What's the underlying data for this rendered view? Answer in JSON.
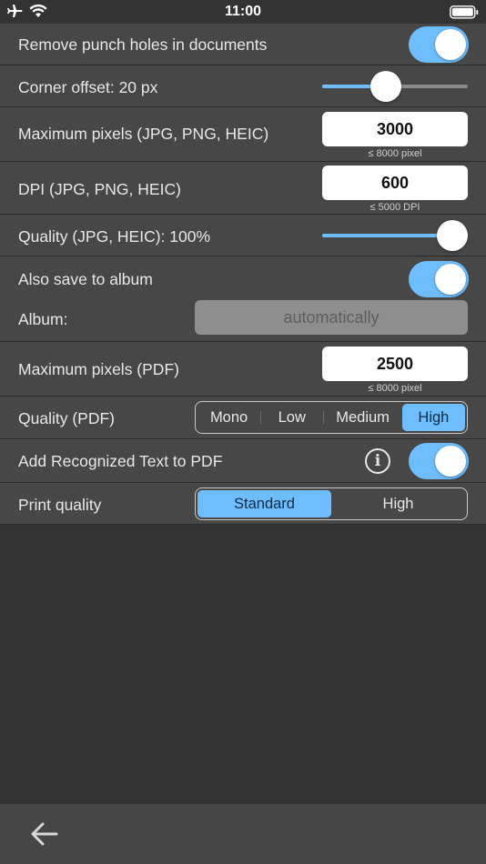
{
  "status": {
    "time": "11:00"
  },
  "rows": {
    "punch": {
      "label": "Remove punch holes in documents",
      "on": true
    },
    "corner": {
      "label": "Corner offset: 20 px",
      "fraction": 0.42
    },
    "maxpx": {
      "label": "Maximum pixels (JPG, PNG, HEIC)",
      "value": "3000",
      "hint": "≤ 8000 pixel"
    },
    "dpi": {
      "label": "DPI (JPG, PNG, HEIC)",
      "value": "600",
      "hint": "≤ 5000 DPI"
    },
    "quality": {
      "label": "Quality (JPG, HEIC): 100%",
      "fraction": 1.0
    },
    "album_save": {
      "label": "Also save to album",
      "on": true
    },
    "album": {
      "label": "Album:",
      "value": "automatically"
    },
    "maxpx_pdf": {
      "label": "Maximum pixels (PDF)",
      "value": "2500",
      "hint": "≤ 8000 pixel"
    },
    "quality_pdf": {
      "label": "Quality (PDF)",
      "options": [
        "Mono",
        "Low",
        "Medium",
        "High"
      ],
      "selected": "High"
    },
    "ocr": {
      "label": "Add Recognized Text to PDF",
      "on": true,
      "info": "i"
    },
    "print": {
      "label": "Print quality",
      "options": [
        "Standard",
        "High"
      ],
      "selected": "Standard"
    }
  },
  "colors": {
    "accent": "#6ebeff",
    "background": "#333333",
    "row": "#474747"
  },
  "icons": [
    "airplane-icon",
    "wifi-icon",
    "battery-icon",
    "info-icon",
    "back-arrow-icon"
  ]
}
